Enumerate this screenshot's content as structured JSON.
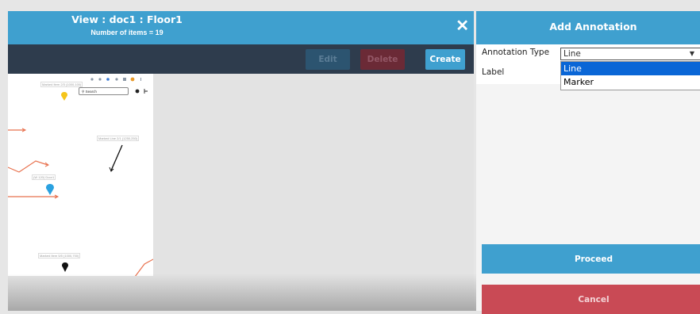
{
  "header": {
    "title": "View : doc1 : Floor1",
    "subtitle": "Number of items = 19",
    "close_icon": "✕"
  },
  "toolbar": {
    "edit_label": "Edit",
    "delete_label": "Delete",
    "create_label": "Create"
  },
  "map": {
    "labels": [
      "Marked Item 2/3 (1000,100)",
      "Marked Line 2/1 (1250,250)",
      "(W 120) Door1",
      "Marked Item 5/5 (1000,700)"
    ],
    "search_placeholder": "Search"
  },
  "panel": {
    "title": "Add Annotation",
    "annotation_type_label": "Annotation Type",
    "annotation_type_value": "Line",
    "label_label": "Label",
    "options": [
      "Line",
      "Marker"
    ],
    "proceed_label": "Proceed",
    "cancel_label": "Cancel"
  },
  "colors": {
    "header": "#3fa0cf",
    "toolbar": "#2e3c4d",
    "cancel": "#c94a55",
    "selected": "#0a66d6"
  }
}
